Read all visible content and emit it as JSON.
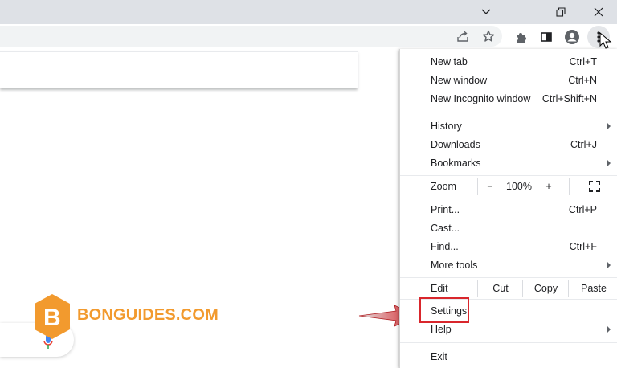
{
  "menu": {
    "group1": [
      {
        "label": "New tab",
        "shortcut": "Ctrl+T"
      },
      {
        "label": "New window",
        "shortcut": "Ctrl+N"
      },
      {
        "label": "New Incognito window",
        "shortcut": "Ctrl+Shift+N"
      }
    ],
    "group2": [
      {
        "label": "History",
        "shortcut": ""
      },
      {
        "label": "Downloads",
        "shortcut": "Ctrl+J"
      },
      {
        "label": "Bookmarks",
        "shortcut": ""
      }
    ],
    "zoom": {
      "label": "Zoom",
      "minus": "−",
      "value": "100%",
      "plus": "+"
    },
    "group3": [
      {
        "label": "Print...",
        "shortcut": "Ctrl+P"
      },
      {
        "label": "Cast...",
        "shortcut": ""
      },
      {
        "label": "Find...",
        "shortcut": "Ctrl+F"
      },
      {
        "label": "More tools",
        "shortcut": ""
      }
    ],
    "edit": {
      "label": "Edit",
      "cut": "Cut",
      "copy": "Copy",
      "paste": "Paste"
    },
    "group4": [
      {
        "label": "Settings",
        "shortcut": ""
      },
      {
        "label": "Help",
        "shortcut": ""
      }
    ],
    "exit": {
      "label": "Exit"
    }
  },
  "watermark": {
    "text": "BONGUIDES.COM",
    "letter": "B"
  },
  "colors": {
    "accent_red": "#d9262c",
    "watermark_orange": "#f29a2e",
    "titlebar": "#dee1e6"
  }
}
